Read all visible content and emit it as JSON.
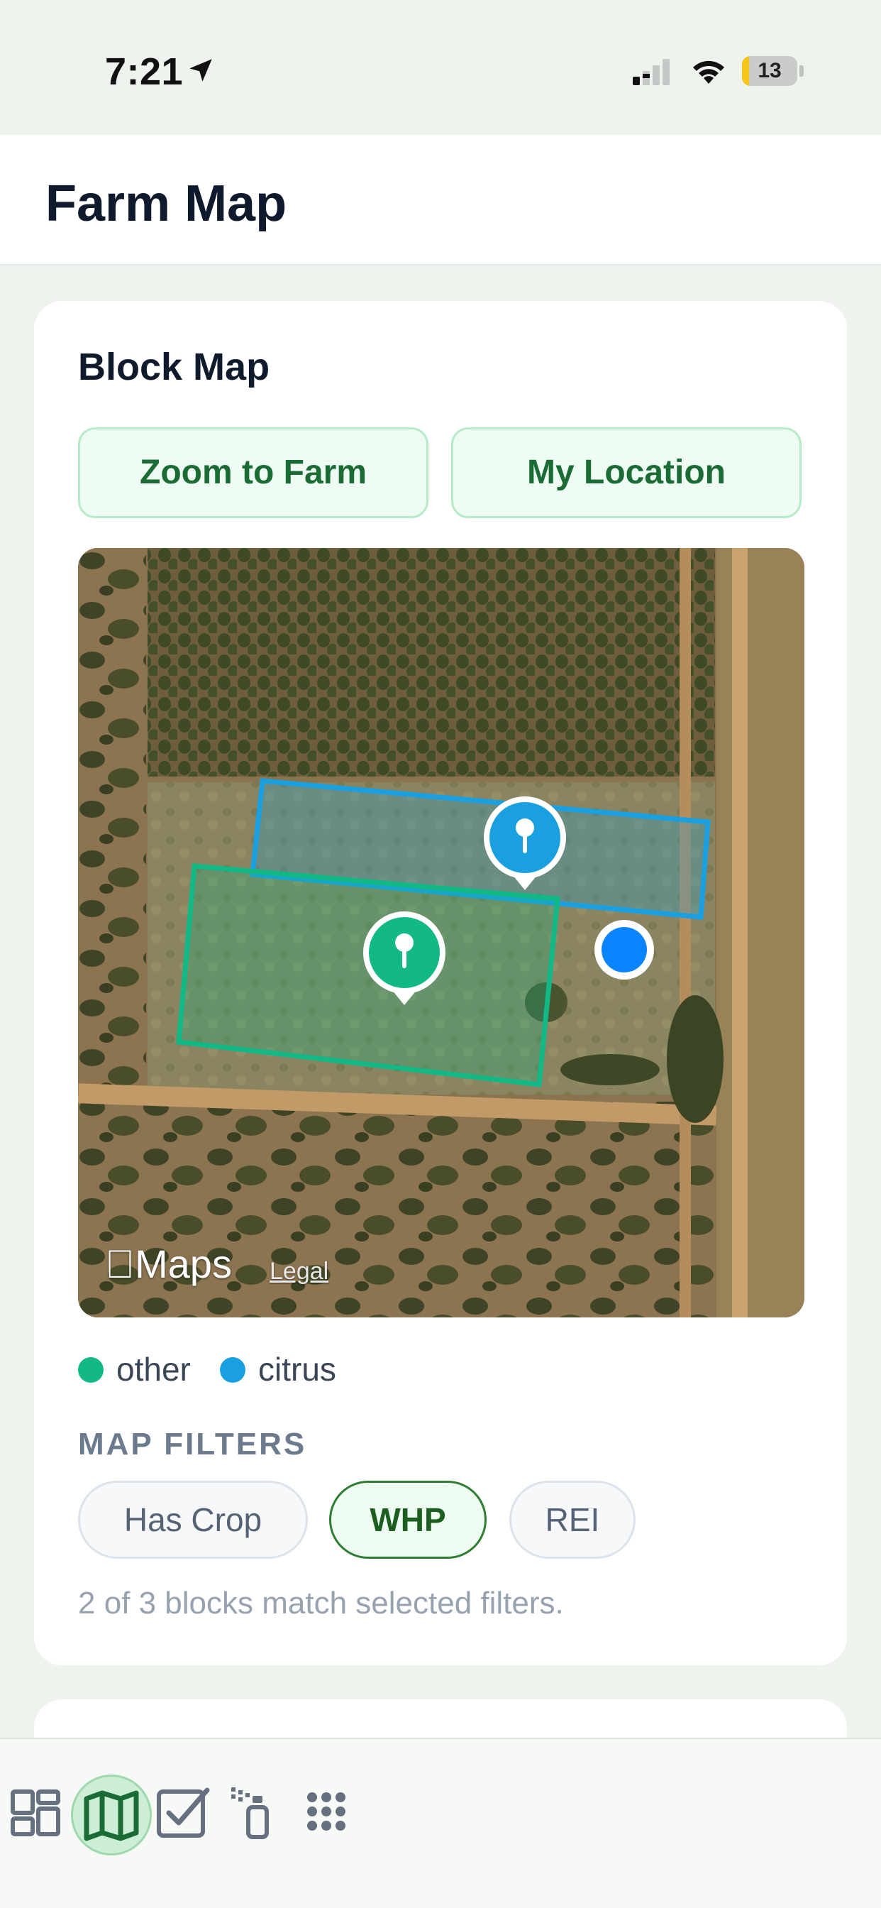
{
  "status_bar": {
    "time": "7:21",
    "battery": "13",
    "battery_level": 0.13,
    "icons": [
      "location-arrow-icon",
      "cellular-signal-icon",
      "wifi-icon",
      "battery-icon"
    ]
  },
  "header": {
    "title": "Farm Map"
  },
  "block_map": {
    "title": "Block Map",
    "zoom_button": "Zoom to Farm",
    "location_button": "My Location",
    "map": {
      "attribution": "Maps",
      "legal": "Legal",
      "blocks": [
        {
          "crop": "citrus",
          "color": "#1aa0e0"
        },
        {
          "crop": "other",
          "color": "#12b886"
        }
      ]
    },
    "legend": [
      {
        "label": "other",
        "color": "#12b886"
      },
      {
        "label": "citrus",
        "color": "#1aa0e0"
      }
    ],
    "filters_title": "MAP FILTERS",
    "filters": [
      {
        "label": "Has Crop",
        "selected": false
      },
      {
        "label": "WHP",
        "selected": true
      },
      {
        "label": "REI",
        "selected": false
      }
    ],
    "match_text": "2 of 3 blocks match selected filters."
  },
  "tab_bar": {
    "tabs": [
      {
        "icon": "dashboard-icon",
        "active": false
      },
      {
        "icon": "map-icon",
        "active": true
      },
      {
        "icon": "checklist-icon",
        "active": false
      },
      {
        "icon": "sprayer-icon",
        "active": false
      },
      {
        "icon": "more-grid-icon",
        "active": false
      }
    ]
  },
  "colors": {
    "accent_green": "#1a6b34",
    "citrus_blue": "#1aa0e0",
    "other_green": "#12b886",
    "location_blue": "#0a84ff"
  }
}
